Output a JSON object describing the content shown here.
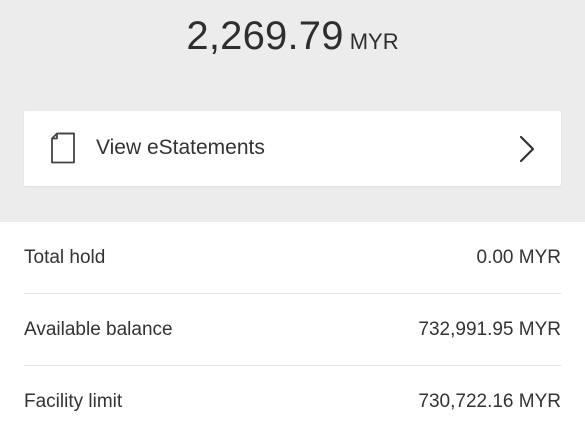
{
  "balance": {
    "amount": "2,269.79",
    "currency": "MYR"
  },
  "estatements": {
    "label": "View eStatements",
    "icon": "document-icon",
    "chevron": "chevron-right-icon"
  },
  "details": [
    {
      "label": "Total hold",
      "value": "0.00 MYR"
    },
    {
      "label": "Available balance",
      "value": "732,991.95 MYR"
    },
    {
      "label": "Facility limit",
      "value": "730,722.16 MYR"
    }
  ],
  "colors": {
    "header_bg": "#ececec",
    "card_bg": "#ffffff",
    "text": "#2b2b2b",
    "divider": "#e1e1e1"
  }
}
